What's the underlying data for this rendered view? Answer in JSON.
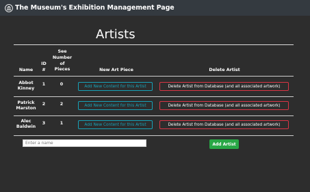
{
  "navbar": {
    "brand_text": "The Museum's Exhibition Management Page",
    "brand_icon": "museum-icon"
  },
  "page": {
    "title": "Artists"
  },
  "table": {
    "headers": {
      "name": "Name",
      "id_line1": "ID",
      "id_line2": "#",
      "pieces_line1": "See",
      "pieces_line2": "Number",
      "pieces_line3": "of",
      "pieces_line4": "Pieces",
      "new_art": "New Art Piece",
      "delete": "Delete Artist"
    },
    "rows": [
      {
        "name_line1": "Abbot",
        "name_line2": "Kinney",
        "id": "1",
        "pieces": "0",
        "add_label": "Add New Content for this Artist",
        "delete_label": "Delete Artist from Database (and all associated artwork)"
      },
      {
        "name_line1": "Patrick",
        "name_line2": "Marston",
        "id": "2",
        "pieces": "2",
        "add_label": "Add New Content for this Artist",
        "delete_label": "Delete Artist from Database (and all associated artwork)"
      },
      {
        "name_line1": "Alec",
        "name_line2": "Baldwin",
        "id": "3",
        "pieces": "1",
        "add_label": "Add New Content for this Artist",
        "delete_label": "Delete Artist from Database (and all associated artwork)"
      }
    ]
  },
  "form": {
    "name_value": "",
    "name_placeholder": "Enter a name",
    "submit_label": "Add Artist"
  },
  "colors": {
    "background": "#2d2d2d",
    "navbar": "#343a40",
    "info": "#17a2b8",
    "danger": "#dc3545",
    "success": "#28a745"
  }
}
